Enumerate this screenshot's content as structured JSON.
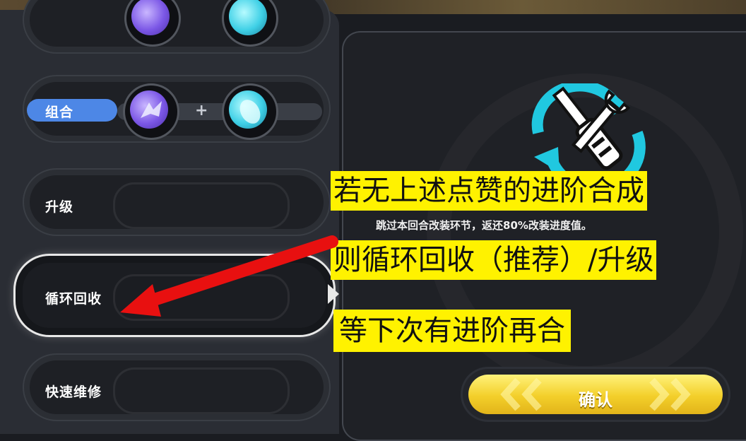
{
  "menu": {
    "combo_label": "组合",
    "combo_plus": "+",
    "upgrade_label": "升级",
    "recycle_label": "循环回收",
    "repair_label": "快速维修"
  },
  "detail": {
    "icon": "wrench-screwdriver-recycle-icon",
    "description": "跳过本回合改装环节，返还80%改装进度值。",
    "confirm_label": "确认"
  },
  "annotations": {
    "line1": "若无上述点赞的进阶合成",
    "line2": "则循环回收（推荐）/升级",
    "line3": "等下次有进阶再合"
  },
  "colors": {
    "accent_blue": "#4d87e6",
    "confirm_yellow": "#f3cf2a",
    "highlight_yellow": "#fff200",
    "arrow_red": "#e81010",
    "icon_cyan": "#20c8e0"
  }
}
